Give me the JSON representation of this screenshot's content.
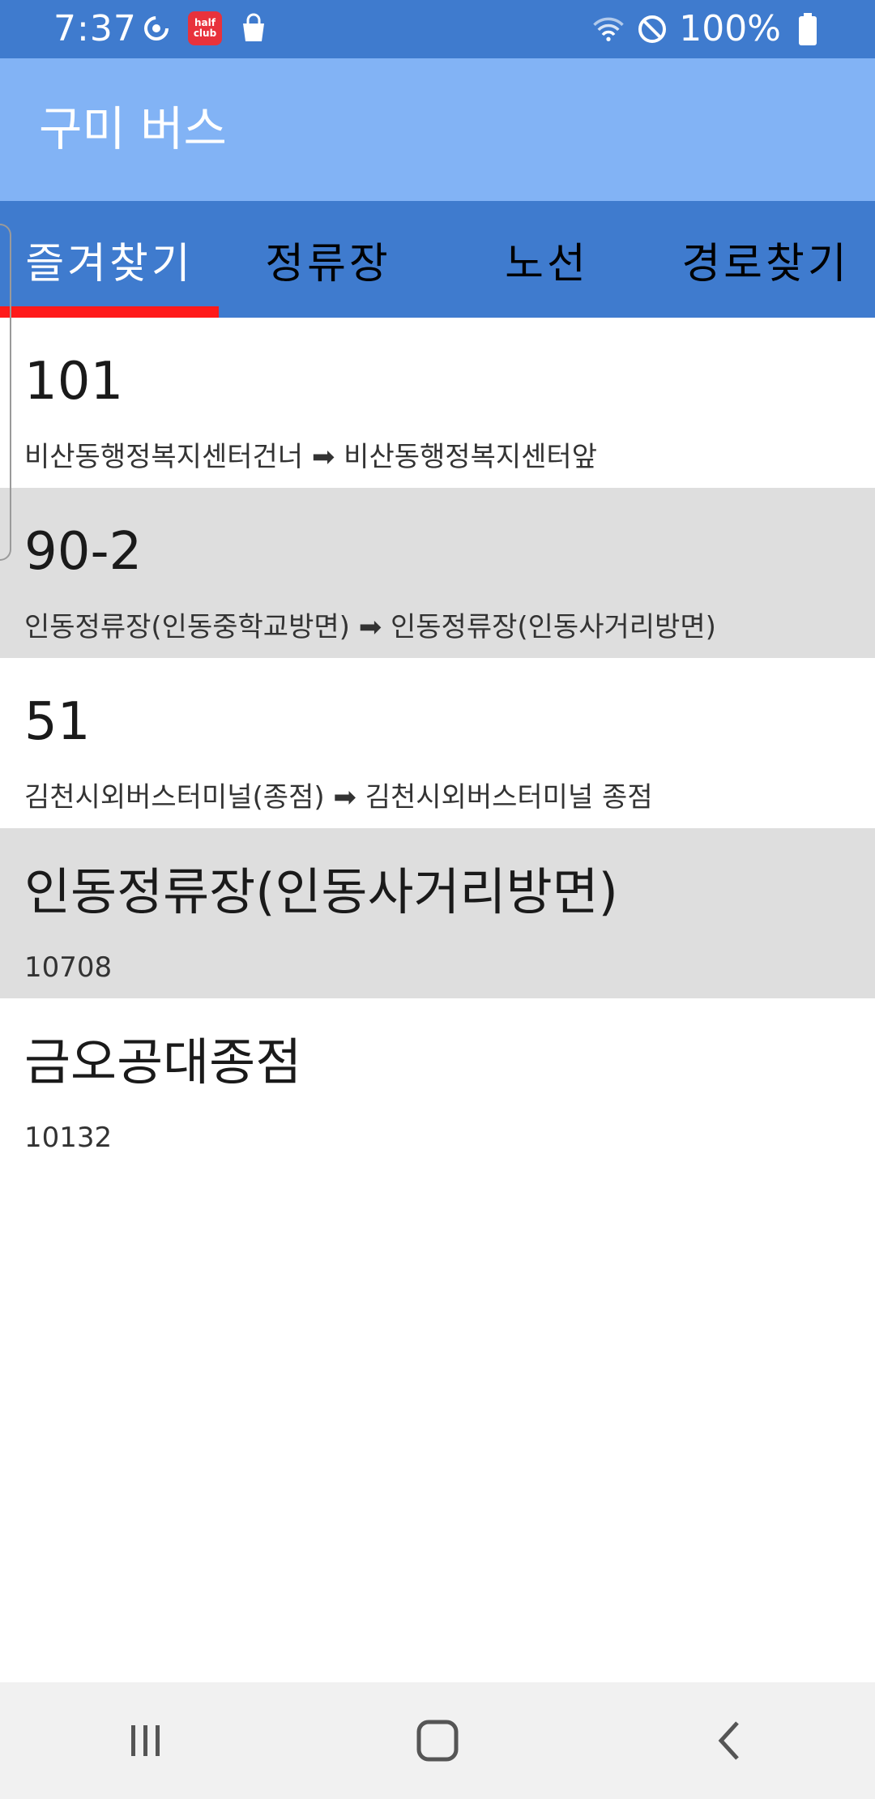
{
  "status_bar": {
    "time": "7:37",
    "left_icons": [
      "sync-icon",
      "half-club-app-icon",
      "shopping-bag-icon"
    ],
    "half_club_text_line1": "half",
    "half_club_text_line2": "club",
    "right_icons": [
      "wifi-icon",
      "do-not-disturb-icon",
      "battery-icon"
    ],
    "battery_percent": "100%"
  },
  "app_bar": {
    "title": "구미 버스"
  },
  "tabs": [
    {
      "label": "즐겨찾기",
      "active": true
    },
    {
      "label": "정류장",
      "active": false
    },
    {
      "label": "노선",
      "active": false
    },
    {
      "label": "경로찾기",
      "active": false
    }
  ],
  "favorites": [
    {
      "title": "101",
      "subtitle": "비산동행정복지센터건너 ➡ 비산동행정복지센터앞",
      "type": "route"
    },
    {
      "title": "90-2",
      "subtitle": "인동정류장(인동중학교방면) ➡ 인동정류장(인동사거리방면)",
      "type": "route"
    },
    {
      "title": "51",
      "subtitle": "김천시외버스터미널(종점) ➡ 김천시외버스터미널 종점",
      "type": "route"
    },
    {
      "title": "인동정류장(인동사거리방면)",
      "subtitle": "10708",
      "type": "stop"
    },
    {
      "title": "금오공대종점",
      "subtitle": "10132",
      "type": "stop"
    }
  ],
  "nav_bar": {
    "buttons": [
      "recent-apps-icon",
      "home-icon",
      "back-icon"
    ]
  },
  "colors": {
    "status_bar": "#3f7bce",
    "app_bar": "#82b3f5",
    "tab_bar": "#3f7bce",
    "tab_indicator": "#ff1a1a",
    "alt_row": "#dedede",
    "nav_bar": "#f1f1f1"
  }
}
